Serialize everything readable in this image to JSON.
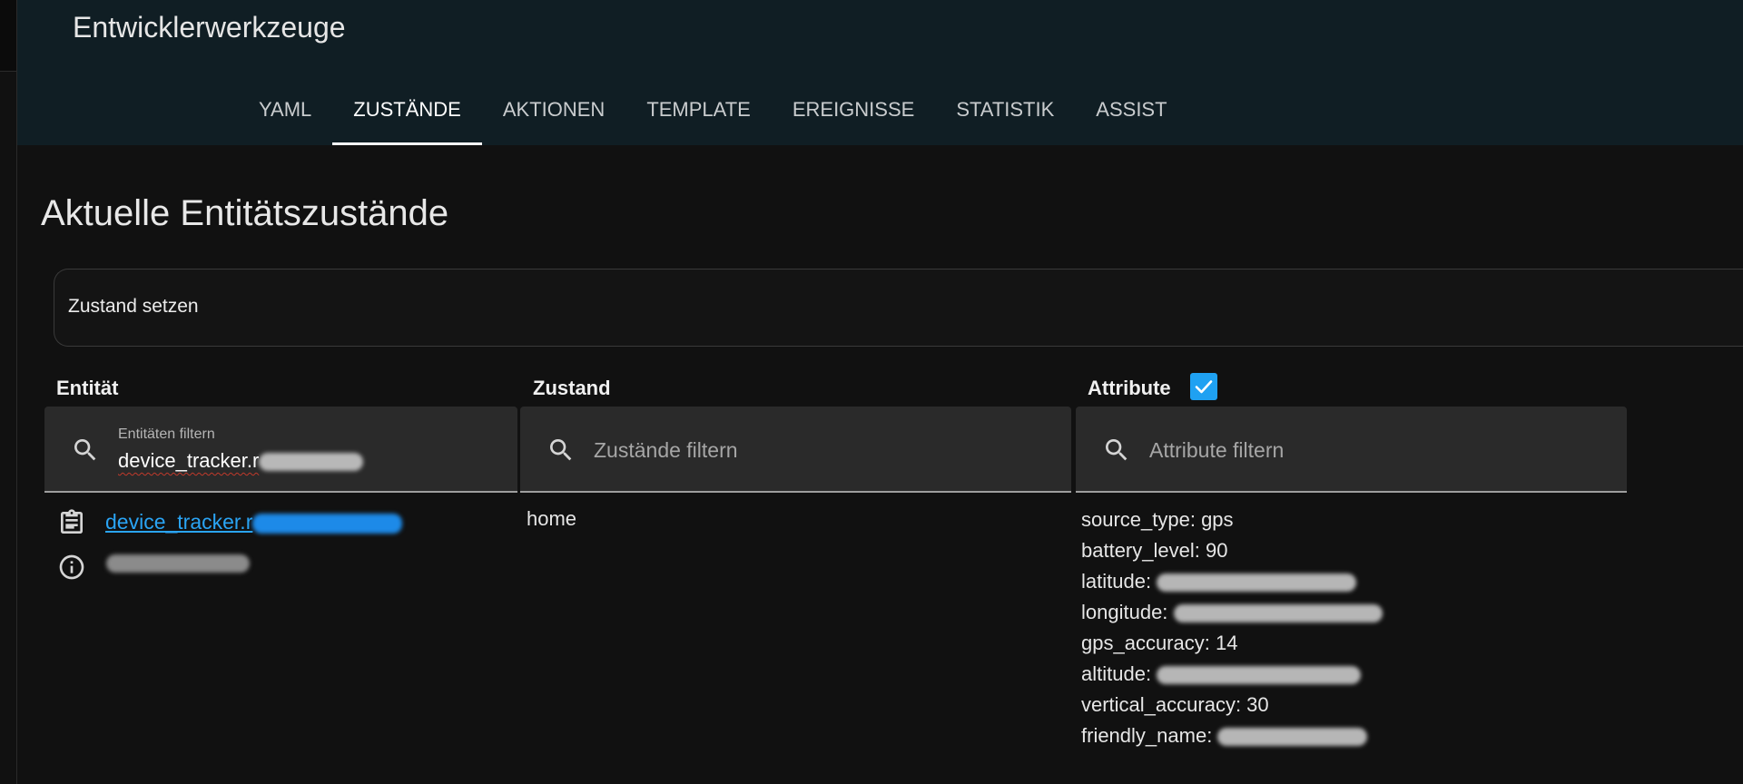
{
  "header": {
    "title": "Entwicklerwerkzeuge",
    "tabs": [
      {
        "label": "YAML",
        "active": false
      },
      {
        "label": "ZUSTÄNDE",
        "active": true
      },
      {
        "label": "AKTIONEN",
        "active": false
      },
      {
        "label": "TEMPLATE",
        "active": false
      },
      {
        "label": "EREIGNISSE",
        "active": false
      },
      {
        "label": "STATISTIK",
        "active": false
      },
      {
        "label": "ASSIST",
        "active": false
      }
    ]
  },
  "main": {
    "heading": "Aktuelle Entitätszustände",
    "set_state_label": "Zustand setzen",
    "columns": {
      "entity": "Entität",
      "state": "Zustand",
      "attributes": "Attribute",
      "attributes_checked": true
    },
    "filters": {
      "entity_label": "Entitäten filtern",
      "entity_value": "device_tracker.r",
      "state_placeholder": "Zustände filtern",
      "attributes_placeholder": "Attribute filtern"
    },
    "row": {
      "entity_id": "device_tracker.r",
      "state": "home",
      "attributes": [
        {
          "text": "source_type: gps",
          "redacted": false
        },
        {
          "text": "battery_level: 90",
          "redacted": false
        },
        {
          "text": "latitude: ",
          "redacted": true
        },
        {
          "text": "longitude: ",
          "redacted": true
        },
        {
          "text": "gps_accuracy: 14",
          "redacted": false
        },
        {
          "text": "altitude: ",
          "redacted": true
        },
        {
          "text": "vertical_accuracy: 30",
          "redacted": false
        },
        {
          "text": "friendly_name: ",
          "redacted": true
        }
      ]
    }
  },
  "icons": {
    "search": "magnify-icon",
    "copy": "clipboard-text-icon",
    "info": "information-outline-icon",
    "check": "check-icon"
  },
  "colors": {
    "header_bg": "#101e24",
    "page_bg": "#111111",
    "accent": "#1fa1f2",
    "link": "#2aa4f4"
  }
}
